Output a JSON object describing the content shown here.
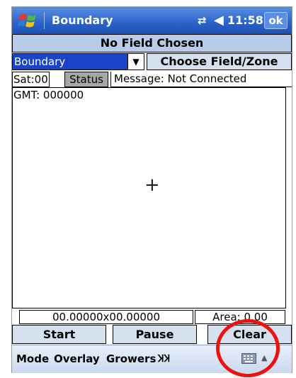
{
  "titlebar": {
    "app_title": "Boundary",
    "time": "11:58",
    "ok_label": "ok",
    "icons": [
      "windows-start-icon",
      "network-icon",
      "volume-icon"
    ]
  },
  "field_banner": "No Field Chosen",
  "field_select": {
    "selected": "Boundary",
    "choose_button": "Choose Field/Zone"
  },
  "status_row": {
    "sat": "Sat:00",
    "status_button": "Status",
    "message": "Message: Not Connected"
  },
  "map": {
    "gmt": "GMT: 000000",
    "crosshair": "+"
  },
  "readouts": {
    "coords": "00.00000x00.00000",
    "area": "Area: 0.00"
  },
  "buttons": {
    "start": "Start",
    "pause": "Pause",
    "clear": "Clear"
  },
  "menubar": {
    "mode": "Mode",
    "overlay": "Overlay",
    "growers": "Growers",
    "tool_glyph": "ꞰꞰ"
  },
  "colors": {
    "titlebar": "#2a62c9",
    "selected_dropdown": "#1a44c8",
    "highlight_circle": "#e11111"
  }
}
